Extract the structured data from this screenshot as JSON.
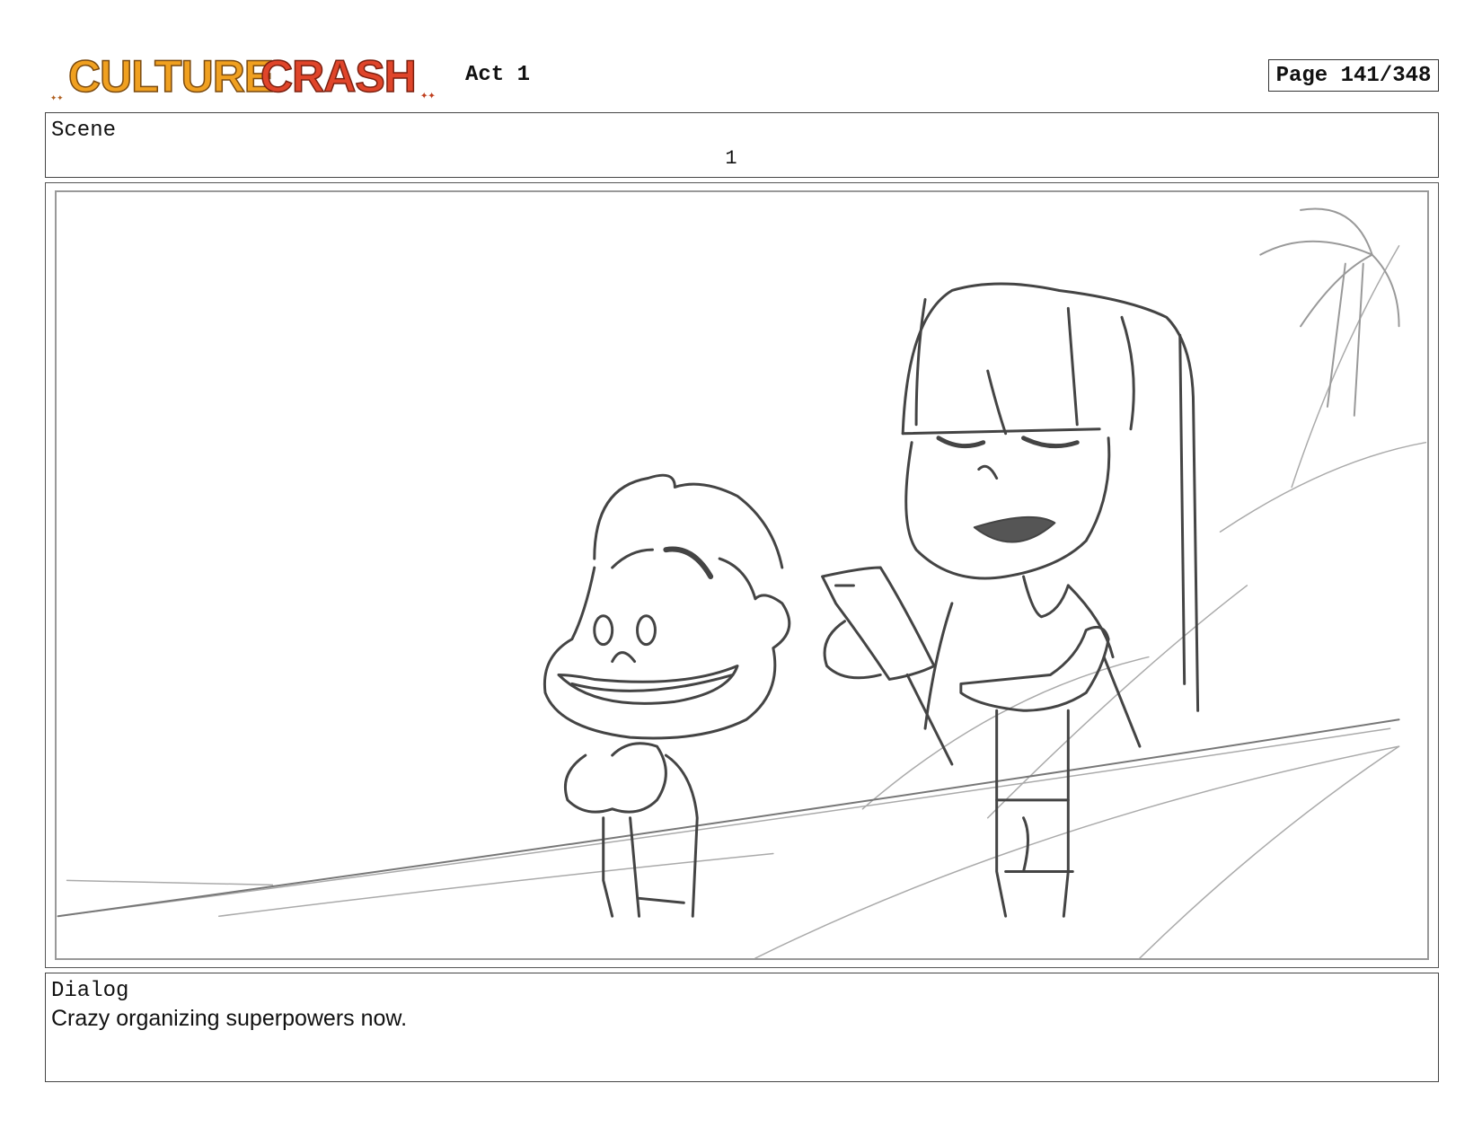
{
  "header": {
    "logo_text": "CULTURE CRASH",
    "act": "Act 1",
    "page": "Page 141/348"
  },
  "scene": {
    "label": "Scene",
    "number": "1"
  },
  "panel": {
    "drawing_style": "pencil-sketch"
  },
  "dialog": {
    "label": "Dialog",
    "text": "Crazy organizing superpowers now."
  },
  "colors": {
    "logo_orange": "#f0a020",
    "logo_red": "#e0452a",
    "sketch_line": "#444444",
    "sketch_light": "#aaaaaa"
  }
}
